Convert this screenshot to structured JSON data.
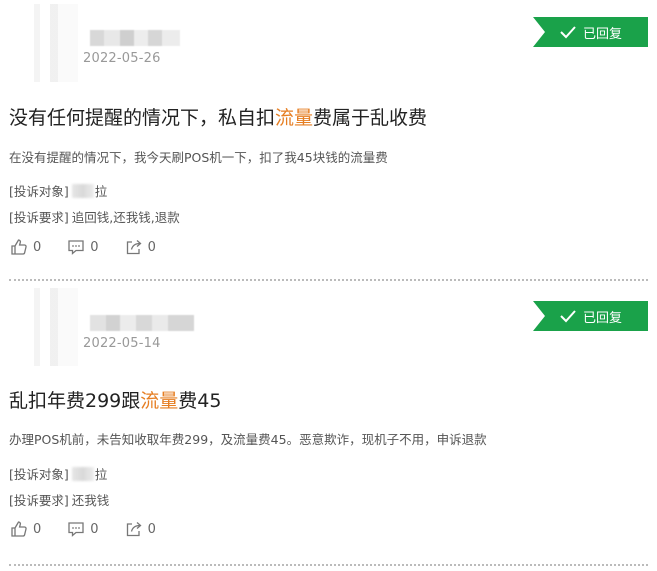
{
  "posts": [
    {
      "date": "2022-05-26",
      "status": "已回复",
      "title_before": "没有任何提醒的情况下，私自扣",
      "title_highlight": "流量",
      "title_after": "费属于乱收费",
      "description": "在没有提醒的情况下，我今天刷POS机一下，扣了我45块钱的流量费",
      "target_label": "[投诉对象]",
      "target_value": "拉",
      "demand_label": "[投诉要求]",
      "demand_value": "追回钱,还我钱,退款",
      "likes": "0",
      "comments": "0",
      "shares": "0"
    },
    {
      "date": "2022-05-14",
      "status": "已回复",
      "title_before": "乱扣年费299跟",
      "title_highlight": "流量",
      "title_after": "费45",
      "description": "办理POS机前，未告知收取年费299，及流量费45。恶意欺诈，现机子不用，申诉退款",
      "target_label": "[投诉对象]",
      "target_value": "拉",
      "demand_label": "[投诉要求]",
      "demand_value": "还我钱",
      "likes": "0",
      "comments": "0",
      "shares": "0"
    }
  ],
  "colors": {
    "badge": "#1aa24a",
    "highlight": "#e67e22"
  },
  "icons": [
    "check-icon",
    "thumbs-up-icon",
    "comment-icon",
    "share-icon"
  ]
}
